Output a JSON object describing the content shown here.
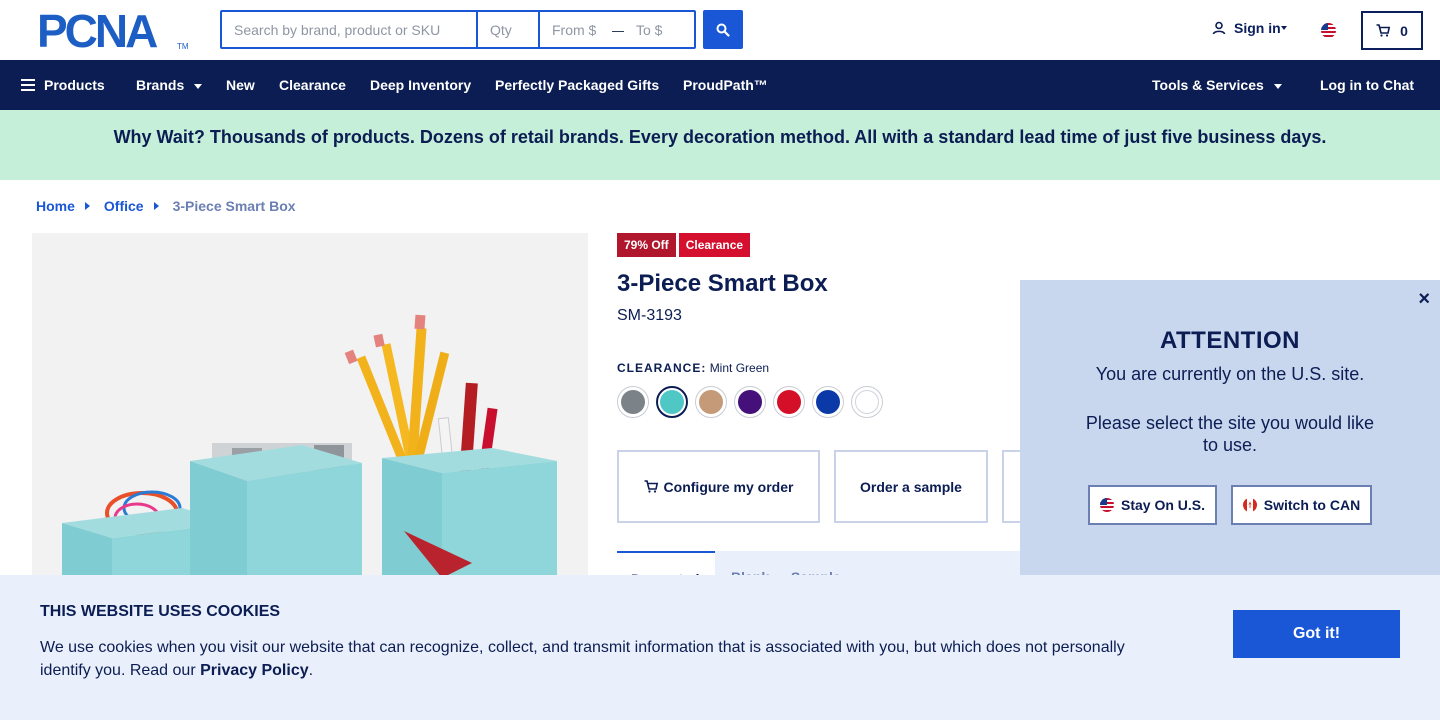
{
  "header": {
    "logo_text": "PCNA",
    "logo_tm": "TM",
    "search_placeholder": "Search by brand, product or SKU",
    "qty_placeholder": "Qty",
    "from_placeholder": "From $",
    "to_placeholder": "To $",
    "dash": "—",
    "signin_label": "Sign in",
    "cart_count": "0"
  },
  "nav": {
    "products": "Products",
    "brands": "Brands",
    "new": "New",
    "clearance": "Clearance",
    "deep_inventory": "Deep Inventory",
    "gifts": "Perfectly Packaged Gifts",
    "proudpath": "ProudPath™",
    "tools": "Tools & Services",
    "chat": "Log in to Chat"
  },
  "banner": {
    "text": "Why Wait? Thousands of products. Dozens of retail brands. Every decoration method. All with a standard lead time of just five business days."
  },
  "breadcrumb": {
    "home": "Home",
    "office": "Office",
    "current": "3-Piece Smart Box"
  },
  "product": {
    "badge_off": "79% Off",
    "badge_clearance": "Clearance",
    "title": "3-Piece Smart Box",
    "sku": "SM-3193",
    "color_label": "CLEARANCE:",
    "color_value": "Mint Green",
    "swatches": [
      {
        "name": "gray",
        "color": "#7b8288"
      },
      {
        "name": "mint-green",
        "color": "#4fc7c4"
      },
      {
        "name": "tan",
        "color": "#c49a78"
      },
      {
        "name": "purple",
        "color": "#45107a"
      },
      {
        "name": "red",
        "color": "#d31027"
      },
      {
        "name": "blue",
        "color": "#0b3aa8"
      },
      {
        "name": "white",
        "color": "#ffffff"
      }
    ],
    "configure_label": "Configure my order",
    "sample_label": "Order a sample",
    "tab1": "Decorated",
    "tab2": "Blank — Sample"
  },
  "modal": {
    "close": "×",
    "title": "ATTENTION",
    "line1": "You are currently on the U.S. site.",
    "line2": "Please select the site you would like to use.",
    "stay_label": "Stay On U.S.",
    "switch_label": "Switch to CAN"
  },
  "cookies": {
    "title": "THIS WEBSITE USES COOKIES",
    "text_before": "We use cookies when you visit our website that can recognize, collect, and transmit information that is associated with you, but which does not personally identify you. Read our ",
    "link": "Privacy Policy",
    "text_after": ".",
    "button": "Got it!"
  },
  "colors": {
    "navy": "#0b1d53",
    "accent_blue": "#1a57d6",
    "banner_green": "#c6efd9",
    "badge_red": "#d4102e",
    "modal_bg": "#c8d6ee",
    "cookie_bg": "#eaf0fb"
  },
  "icons": {
    "search": "search-icon",
    "user": "user-icon",
    "flag": "us-flag-icon",
    "cart": "cart-icon",
    "menu": "hamburger-icon",
    "close": "close-icon"
  }
}
